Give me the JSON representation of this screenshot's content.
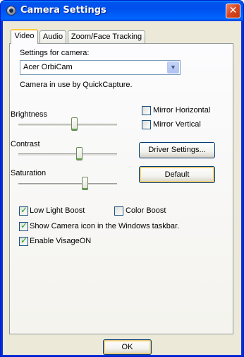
{
  "window": {
    "title": "Camera Settings",
    "close_symbol": "✕"
  },
  "tabs": [
    {
      "label": "Video",
      "active": true
    },
    {
      "label": "Audio",
      "active": false
    },
    {
      "label": "Zoom/Face Tracking",
      "active": false
    }
  ],
  "video": {
    "settings_for_camera_label": "Settings for camera:",
    "camera_select": {
      "value": "Acer OrbiCam",
      "arrow": "▼"
    },
    "camera_status": "Camera in use by QuickCapture.",
    "brightness": {
      "label": "Brightness",
      "level": 0.55
    },
    "contrast": {
      "label": "Contrast",
      "level": 0.6
    },
    "saturation": {
      "label": "Saturation",
      "level": 0.65
    },
    "mirror_horizontal": {
      "label": "Mirror Horizontal",
      "checked": false
    },
    "mirror_vertical": {
      "label": "Mirror Vertical",
      "checked": false
    },
    "driver_settings_button": "Driver Settings...",
    "default_button": "Default",
    "low_light_boost": {
      "label": "Low Light Boost",
      "checked": true
    },
    "color_boost": {
      "label": "Color Boost",
      "checked": false
    },
    "show_camera_icon": {
      "label": "Show Camera icon in the Windows taskbar.",
      "checked": true
    },
    "enable_visageon": {
      "label": "Enable VisageON",
      "checked": true
    }
  },
  "footer": {
    "ok_button": "OK"
  },
  "colors": {
    "titlebar": "#0054e3",
    "close_button": "#d7461f",
    "dialog_bg": "#ece9d8"
  },
  "icons": {
    "app": "webcam-icon",
    "close": "close-icon"
  }
}
